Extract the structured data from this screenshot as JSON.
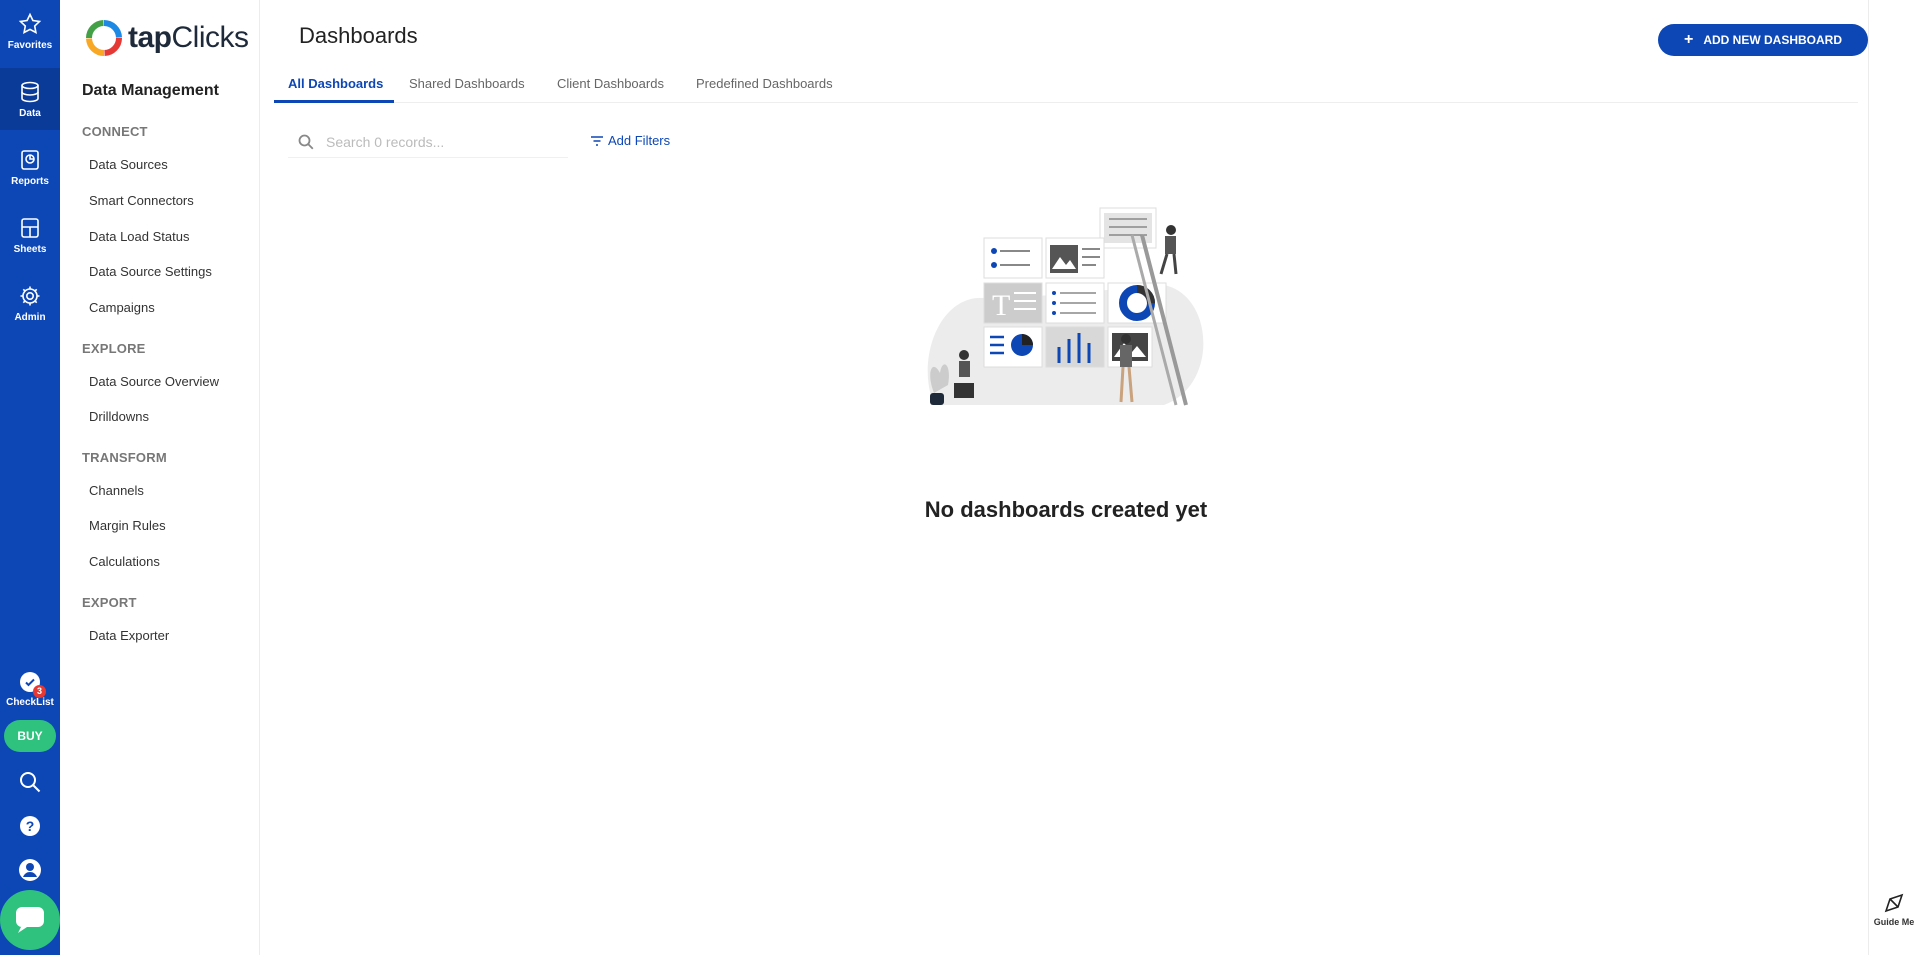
{
  "rail": {
    "items": [
      {
        "label": "Favorites",
        "icon": "star-icon"
      },
      {
        "label": "Data",
        "icon": "database-icon"
      },
      {
        "label": "Reports",
        "icon": "report-icon"
      },
      {
        "label": "Sheets",
        "icon": "sheet-icon"
      },
      {
        "label": "Admin",
        "icon": "gear-icon"
      }
    ],
    "checklist_label": "CheckList",
    "checklist_badge": "3",
    "buy_label": "BUY"
  },
  "brand": {
    "tap": "tap",
    "clicks": "Clicks"
  },
  "sidebar": {
    "title": "Data Management",
    "sections": [
      {
        "heading": "CONNECT",
        "items": [
          "Data Sources",
          "Smart Connectors",
          "Data Load Status",
          "Data Source Settings",
          "Campaigns"
        ]
      },
      {
        "heading": "EXPLORE",
        "items": [
          "Data Source Overview",
          "Drilldowns"
        ]
      },
      {
        "heading": "TRANSFORM",
        "items": [
          "Channels",
          "Margin Rules",
          "Calculations"
        ]
      },
      {
        "heading": "EXPORT",
        "items": [
          "Data Exporter"
        ]
      }
    ]
  },
  "main": {
    "title": "Dashboards",
    "add_button": "ADD NEW DASHBOARD",
    "tabs": [
      "All Dashboards",
      "Shared Dashboards",
      "Client Dashboards",
      "Predefined Dashboards"
    ],
    "search_placeholder": "Search 0 records...",
    "filters_label": "Add Filters",
    "empty_message": "No dashboards created yet"
  },
  "guide_label": "Guide Me",
  "colors": {
    "primary": "#0d47b5",
    "accent": "#2ec27e"
  }
}
